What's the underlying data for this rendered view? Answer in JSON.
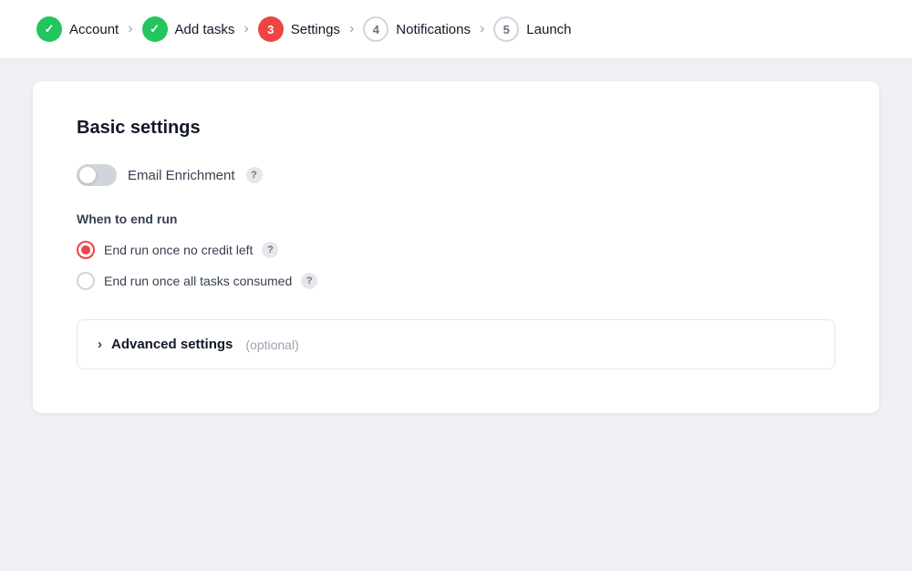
{
  "stepper": {
    "steps": [
      {
        "id": "account",
        "number": "✓",
        "label": "Account",
        "state": "completed"
      },
      {
        "id": "add-tasks",
        "number": "✓",
        "label": "Add tasks",
        "state": "completed"
      },
      {
        "id": "settings",
        "number": "3",
        "label": "Settings",
        "state": "active"
      },
      {
        "id": "notifications",
        "number": "4",
        "label": "Notifications",
        "state": "inactive"
      },
      {
        "id": "launch",
        "number": "5",
        "label": "Launch",
        "state": "inactive"
      }
    ]
  },
  "card": {
    "title": "Basic settings",
    "toggle": {
      "label": "Email Enrichment",
      "enabled": false
    },
    "when_to_end": {
      "section_label": "When to end run",
      "options": [
        {
          "id": "no-credit",
          "label": "End run once no credit left",
          "selected": true
        },
        {
          "id": "all-tasks",
          "label": "End run once all tasks consumed",
          "selected": false
        }
      ]
    },
    "advanced": {
      "title": "Advanced settings",
      "optional_label": "(optional)"
    }
  }
}
